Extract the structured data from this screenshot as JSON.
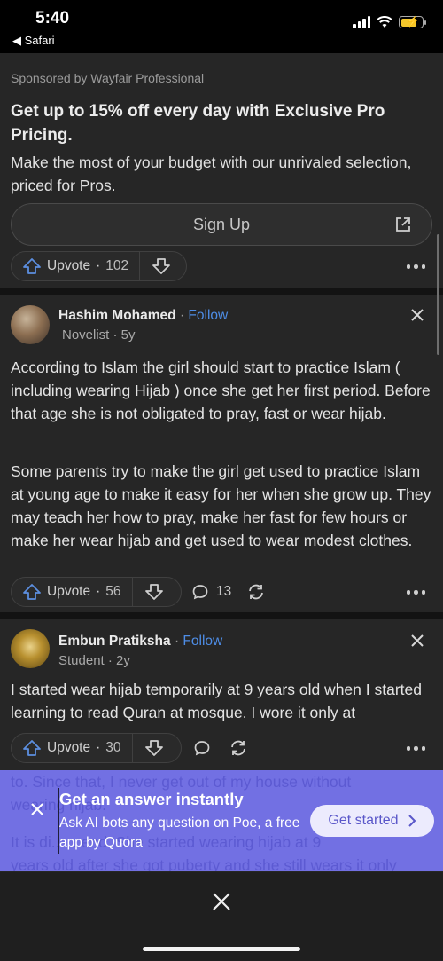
{
  "status_bar": {
    "time": "5:40",
    "back_app": "◀ Safari"
  },
  "ad": {
    "sponsor": "Sponsored by Wayfair Professional",
    "title": "Get up to 15% off every day with Exclusive Pro Pricing.",
    "body": "Make the most of your budget with our unrivaled selection, priced for Pros.",
    "cta_label": "Sign Up",
    "upvote_label": "Upvote",
    "upvote_count": "102"
  },
  "answers": [
    {
      "author": "Hashim Mohamed",
      "follow_label": "Follow",
      "credential": "Novelist · 5y",
      "paragraphs": [
        "According to Islam the girl should start to practice Islam ( including wearing Hijab ) once she get her first period. Before that age she is not obligated to pray, fast or wear hijab.",
        "Some parents try to make the girl get used to practice Islam at young age to make it easy for her when she grow up. They may teach her how to pray, make her fast for few hours or make her wear hijab and get used to wear modest clothes."
      ],
      "upvote_label": "Upvote",
      "upvote_count": "56",
      "comment_count": "13"
    },
    {
      "author": "Embun Pratiksha",
      "follow_label": "Follow",
      "credential": "Student · 2y",
      "paragraphs": [
        "I started wear hijab temporarily at 9 years old when I started learning to read Quran at mosque. I wore it only at"
      ],
      "upvote_label": "Upvote",
      "upvote_count": "30",
      "hidden_lines": [
        "to. Since that, I never get out of my house without",
        "wearing hijab.",
        "It is di... ...end. She started wearing hijab at 9",
        "years old after she got puberty and she still wears it only"
      ]
    }
  ],
  "banner": {
    "title": "Get an answer instantly",
    "body": "Ask AI bots any question on Poe, a free app by Quora",
    "cta_label": "Get started"
  },
  "colors": {
    "accent_link": "#4e8de6",
    "banner_bg": "#7573e9",
    "card_bg": "#262626"
  }
}
